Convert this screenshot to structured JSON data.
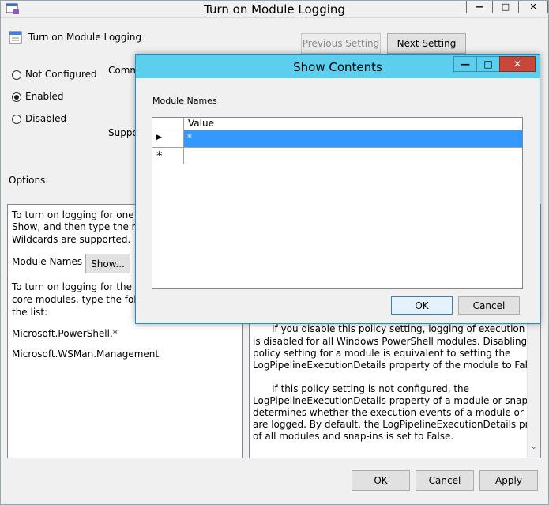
{
  "window": {
    "title": "Turn on Module Logging",
    "setting_name": "Turn on Module Logging",
    "previous_setting_label": "Previous Setting",
    "next_setting_label": "Next Setting",
    "comment_label": "Comm",
    "supported_label": "Suppo",
    "options_label": "Options:",
    "radio": {
      "not_configured": "Not Configured",
      "enabled": "Enabled",
      "disabled": "Disabled",
      "selected": "enabled"
    },
    "options_text": {
      "line1": "To turn on logging for one or",
      "line2": "Show, and then type the modu",
      "line3": "Wildcards are supported.",
      "module_names_label": "Module Names",
      "show_button": "Show...",
      "line4": "To turn on logging for the Win",
      "line5": "core modules, type the follow",
      "line6": "the list:",
      "module1": "Microsoft.PowerShell.*",
      "module2": "Microsoft.WSMan.Management"
    },
    "help_text": {
      "p1_l1": "If you disable this policy setting, logging of execution events",
      "p1_l2": "is disabled for all Windows PowerShell modules. Disabling this",
      "p1_l3": "policy setting for a module is equivalent to setting the",
      "p1_l4": "LogPipelineExecutionDetails property of the module to False.",
      "p2_l1": "If this policy setting is not configured, the",
      "p2_l2": "LogPipelineExecutionDetails property of a module or snap-in",
      "p2_l3": "determines whether the execution events of a module or snap-in",
      "p2_l4": "are logged. By default, the LogPipelineExecutionDetails property",
      "p2_l5": "of all modules and snap-ins is set to False."
    },
    "ok_label": "OK",
    "cancel_label": "Cancel",
    "apply_label": "Apply"
  },
  "dialog": {
    "title": "Show Contents",
    "list_label": "Module Names",
    "column_header": "Value",
    "rows": [
      "*"
    ],
    "new_row_marker": "*",
    "current_row_marker": "▶",
    "ok_label": "OK",
    "cancel_label": "Cancel"
  },
  "colors": {
    "dialog_titlebar": "#5ccfee",
    "close_button": "#c7473b",
    "selection": "#3399ff"
  }
}
